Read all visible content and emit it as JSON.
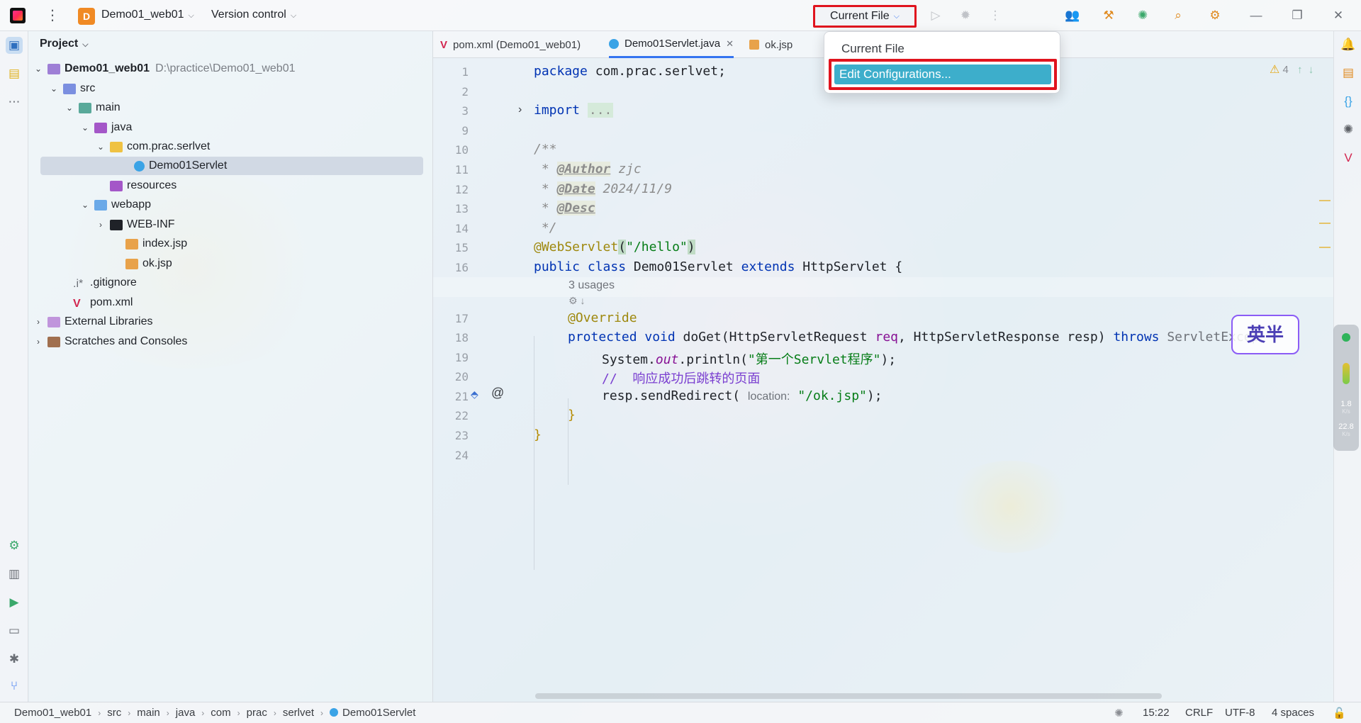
{
  "titlebar": {
    "project_badge": "D",
    "project_name": "Demo01_web01",
    "version_control": "Version control",
    "run_config": "Current File"
  },
  "dropdown": {
    "header": "Current File",
    "item": "Edit Configurations..."
  },
  "project_panel": {
    "title": "Project",
    "tree": [
      {
        "label": "Demo01_web01",
        "hint": "D:\\practice\\Demo01_web01",
        "icon": "module-icon"
      },
      {
        "label": "src",
        "icon": "source-folder-icon"
      },
      {
        "label": "main",
        "icon": "folder-icon"
      },
      {
        "label": "java",
        "icon": "source-root-icon"
      },
      {
        "label": "com.prac.serlvet",
        "icon": "package-icon"
      },
      {
        "label": "Demo01Servlet",
        "icon": "class-icon"
      },
      {
        "label": "resources",
        "icon": "resources-folder-icon"
      },
      {
        "label": "webapp",
        "icon": "web-folder-icon"
      },
      {
        "label": "WEB-INF",
        "icon": "folder-icon"
      },
      {
        "label": "index.jsp",
        "icon": "jsp-file-icon"
      },
      {
        "label": "ok.jsp",
        "icon": "jsp-file-icon"
      },
      {
        "label": ".gitignore",
        "icon": "gitignore-icon"
      },
      {
        "label": "pom.xml",
        "icon": "maven-icon"
      },
      {
        "label": "External Libraries",
        "icon": "library-icon"
      },
      {
        "label": "Scratches and Consoles",
        "icon": "scratches-icon"
      }
    ]
  },
  "tabs": [
    {
      "label": "pom.xml (Demo01_web01)",
      "icon": "maven-icon"
    },
    {
      "label": "Demo01Servlet.java",
      "icon": "class-icon"
    },
    {
      "label": "ok.jsp",
      "icon": "jsp-file-icon"
    }
  ],
  "editor": {
    "line_numbers": [
      "1",
      "2",
      "3",
      "9",
      "10",
      "11",
      "12",
      "13",
      "14",
      "15",
      "16",
      "17",
      "18",
      "19",
      "20",
      "21",
      "22",
      "23",
      "24"
    ],
    "code": {
      "l1_kw": "package",
      "l1_rest": " com.prac.serlvet;",
      "l3_kw": "import",
      "l3_fold": "...",
      "l10": "/**",
      "l11_pre": " * ",
      "l11_tag": "@Author",
      "l11_val": " zjc",
      "l12_pre": " * ",
      "l12_tag": "@Date",
      "l12_val": " 2024/11/9",
      "l13_pre": " * ",
      "l13_tag": "@Desc",
      "l14": " */",
      "l15_ann": "@WebServlet",
      "l15_p1": "(",
      "l15_str": "\"/hello\"",
      "l15_p2": ")",
      "l16_kw1": "public class",
      "l16_name": " Demo01Servlet ",
      "l16_kw2": "extends",
      "l16_rest": " HttpServlet {",
      "usages": "3 usages",
      "l17": "@Override",
      "l18_kw1": "protected void",
      "l18_m": " doGet(HttpServletRequest ",
      "l18_p1": "req",
      "l18_m2": ", HttpServletResponse ",
      "l18_p2": "resp",
      "l18_m3": ") ",
      "l18_kw2": "throws",
      "l18_rest": " ServletExcep",
      "l19_a": "System.",
      "l19_field": "out",
      "l19_b": ".println(",
      "l19_str": "\"第一个Servlet程序\"",
      "l19_c": ");",
      "l20": "//  响应成功后跳转的页面",
      "l21_a": "resp.sendRedirect( ",
      "l21_hint": "location:",
      "l21_str": " \"/ok.jsp\"",
      "l21_b": ");",
      "l22": "}",
      "l23": "}"
    },
    "warnings": "4"
  },
  "statusbar": {
    "breadcrumb": [
      "Demo01_web01",
      "src",
      "main",
      "java",
      "com",
      "prac",
      "serlvet",
      "Demo01Servlet"
    ],
    "position": "15:22",
    "line_sep": "CRLF",
    "encoding": "UTF-8",
    "indent": "4 spaces"
  },
  "overlays": {
    "ime_badge": "英半",
    "net_up": "1.8",
    "net_up_unit": "K/s",
    "net_down": "22.8",
    "net_down_unit": "K/s"
  }
}
